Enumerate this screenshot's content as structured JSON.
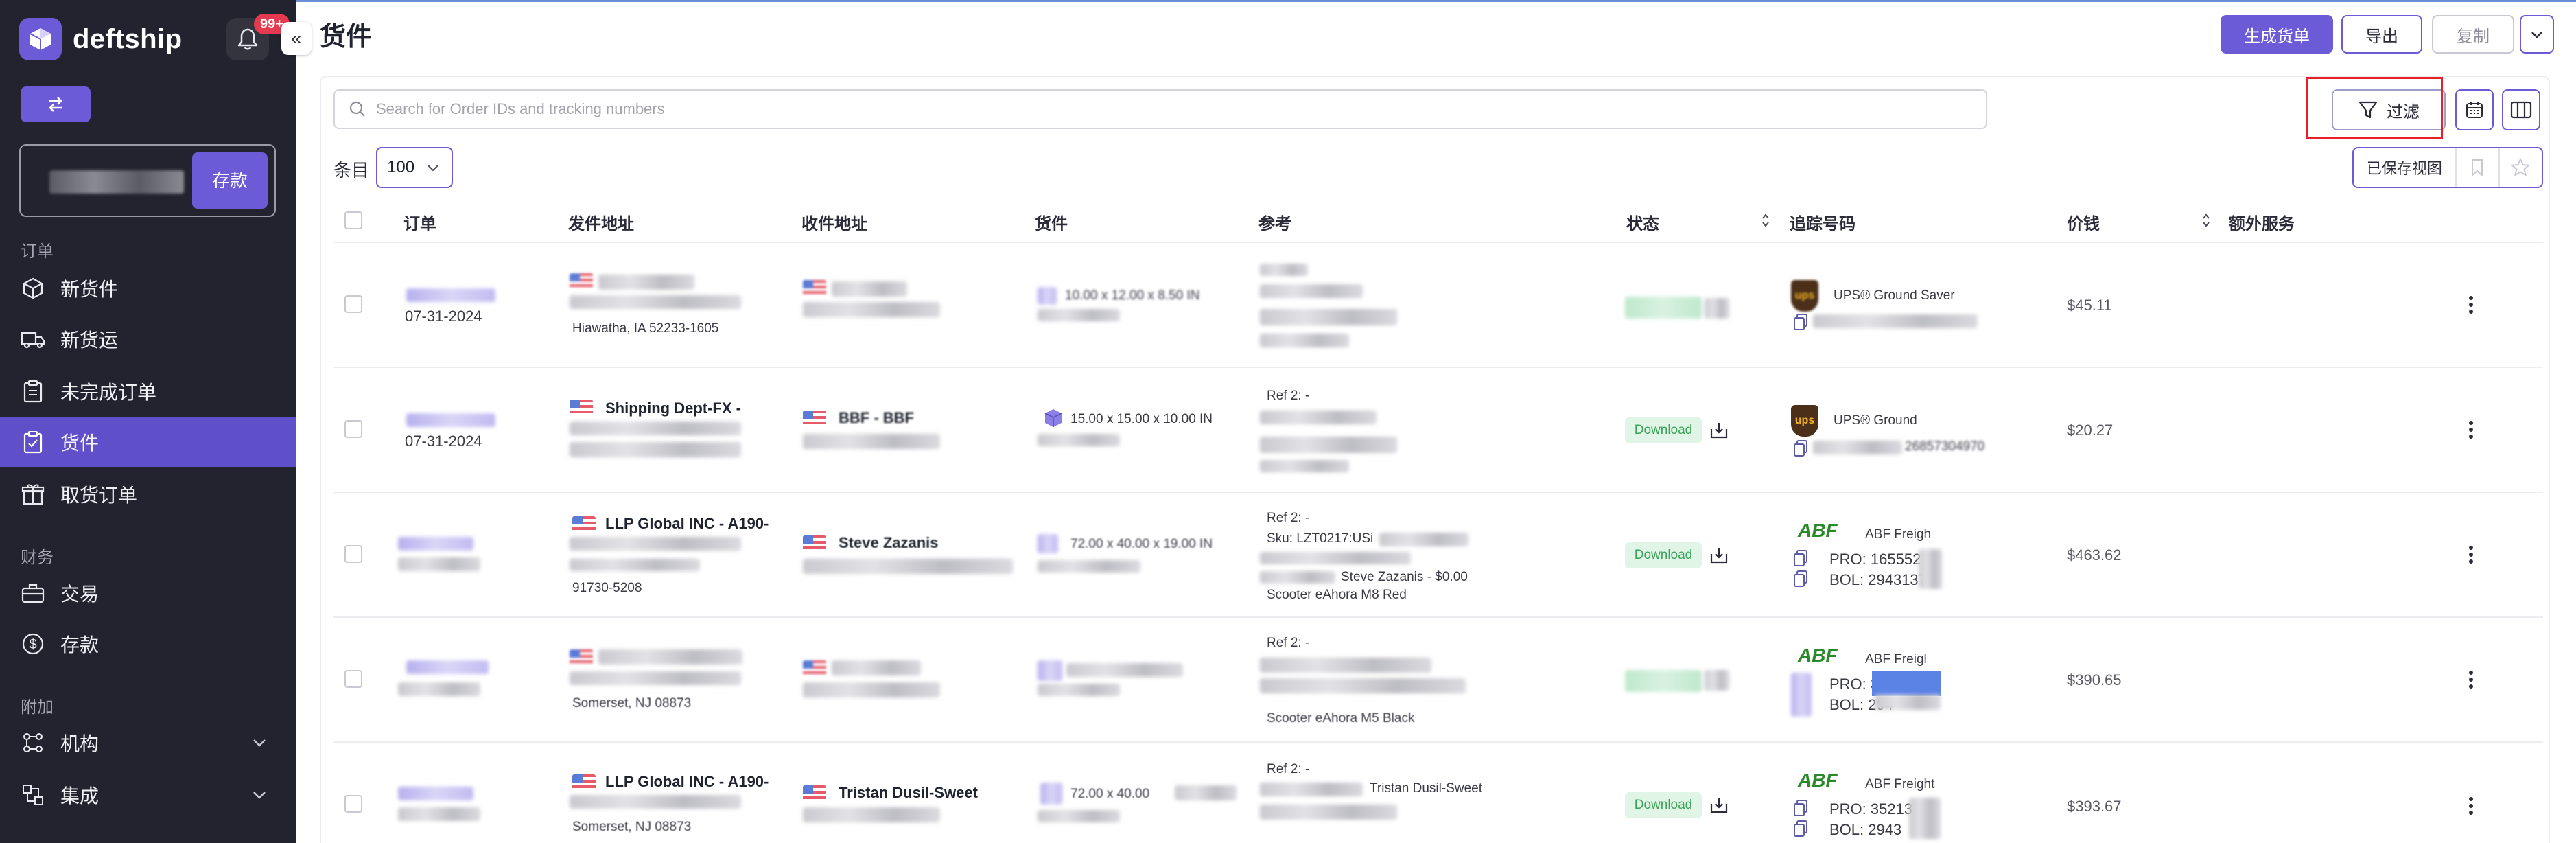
{
  "app": {
    "logo_text": "deftship",
    "notification_badge": "99+",
    "collapse_glyph": "«"
  },
  "sidebar": {
    "deposit_label": "存款",
    "sections": [
      {
        "title": "订单"
      },
      {
        "title": "财务"
      },
      {
        "title": "附加"
      }
    ],
    "items": [
      {
        "label": "新货件",
        "icon": "cube-icon"
      },
      {
        "label": "新货运",
        "icon": "truck-icon"
      },
      {
        "label": "未完成订单",
        "icon": "clipboard-icon"
      },
      {
        "label": "货件",
        "icon": "clipboard-check-icon",
        "active": true
      },
      {
        "label": "取货订单",
        "icon": "gift-box-icon"
      },
      {
        "label": "交易",
        "icon": "briefcase-icon"
      },
      {
        "label": "存款",
        "icon": "dollar-circle-icon"
      },
      {
        "label": "机构",
        "icon": "network-icon",
        "expandable": true
      },
      {
        "label": "集成",
        "icon": "integration-icon",
        "expandable": true
      }
    ]
  },
  "header": {
    "title": "货件",
    "create_button": "生成货单",
    "export_button": "导出",
    "copy_button": "复制"
  },
  "toolbar": {
    "search_placeholder": "Search for Order IDs and tracking numbers",
    "filter_label": "过滤",
    "per_page_label": "条目",
    "per_page_value": "100",
    "saved_views_label": "已保存视图"
  },
  "table": {
    "columns": [
      "订单",
      "发件地址",
      "收件地址",
      "货件",
      "参考",
      "状态",
      "追踪号码",
      "价钱",
      "额外服务"
    ],
    "rows": [
      {
        "order_date": "07-31-2024",
        "from_line2": "Hiawatha, IA 52233-1605",
        "shipment": "10.00 x 12.00 x 8.50 IN",
        "carrier": "UPS® Ground Saver",
        "price": "$45.11"
      },
      {
        "order_date": "07-31-2024",
        "from_name": "Shipping Dept-FX -",
        "to_name": "BBF - BBF",
        "shipment": "15.00 x 15.00 x 10.00 IN",
        "ref": "Ref 2: -",
        "status": "Download",
        "carrier": "UPS® Ground",
        "tracking_tail": "26857304970",
        "price": "$20.27"
      },
      {
        "from_name": "LLP Global INC - A190-",
        "from_line2": "91730-5208",
        "to_name": "Steve Zazanis",
        "shipment": "72.00 x 40.00 x 19.00 IN",
        "ref": "Ref 2: -",
        "ref_sku": "Sku: LZT0217:USi",
        "ref_line3": "Steve Zazanis - $0.00",
        "ref_line4": "Scooter eAhora M8 Red",
        "status": "Download",
        "carrier": "ABF Freigh",
        "pro": "PRO:  165552",
        "bol": "BOL:  2943137",
        "price": "$463.62"
      },
      {
        "from_line2": "Somerset, NJ 08873",
        "ref": "Ref 2: -",
        "ref_line4": "Scooter eAhora M5 Black",
        "carrier": "ABF Freigl",
        "pro": "PRO:  352",
        "bol": "BOL:  294",
        "price": "$390.65"
      },
      {
        "from_name": "LLP Global INC - A190-",
        "from_line2": "Somerset, NJ 08873",
        "to_name": "Tristan Dusil-Sweet",
        "shipment": "72.00 x 40.00",
        "ref": "Ref 2: -",
        "ref_line3": "Tristan Dusil-Sweet",
        "status": "Download",
        "carrier": "ABF Freight",
        "pro": "PRO:  35213",
        "bol": "BOL:  2943",
        "price": "$393.67"
      }
    ]
  },
  "colors": {
    "sidebar_bg": "#23232f",
    "accent": "#6b5bd6",
    "active_nav": "#5f4fc9",
    "download_green": "#3aa35a",
    "highlight_red": "#e8202a"
  }
}
